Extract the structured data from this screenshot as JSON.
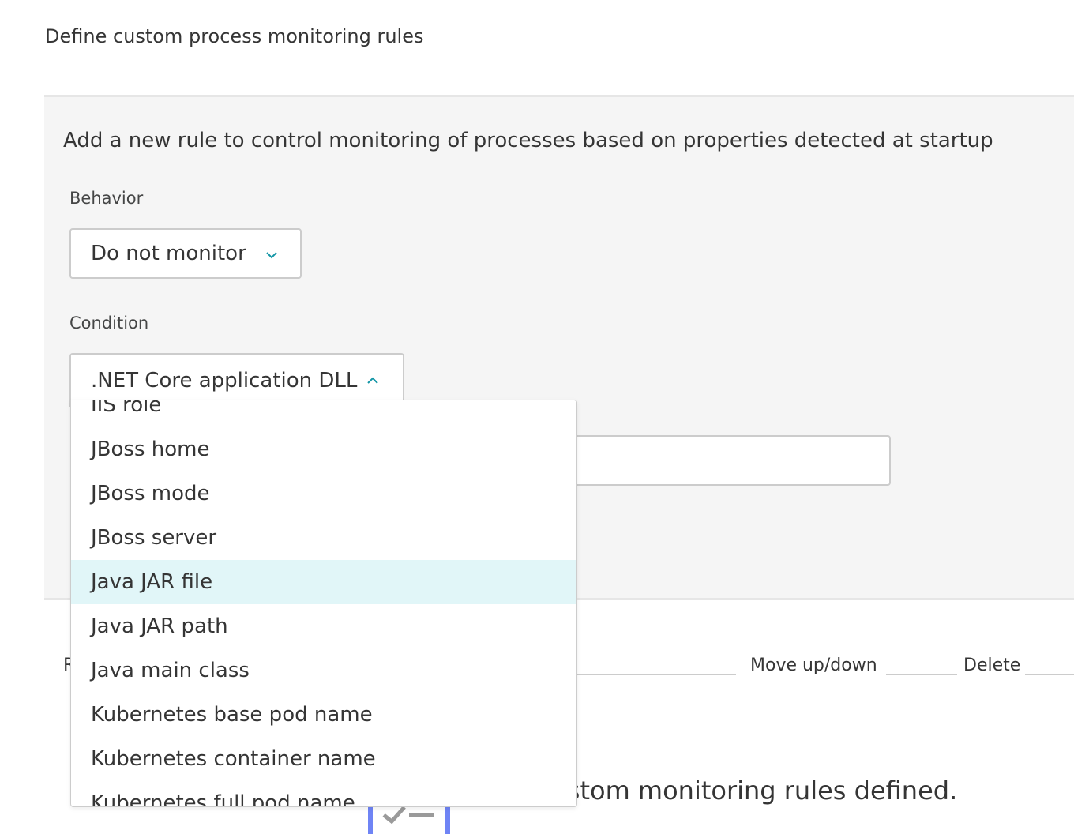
{
  "page": {
    "title": "Define custom process monitoring rules"
  },
  "rule_form": {
    "heading": "Add a new rule to control monitoring of processes based on properties detected at startup",
    "behavior": {
      "label": "Behavior",
      "selected": "Do not monitor"
    },
    "condition": {
      "label": "Condition",
      "selected": ".NET Core application DLL",
      "open": true,
      "options": [
        "IIS role",
        "JBoss home",
        "JBoss mode",
        "JBoss server",
        "Java JAR file",
        "Java JAR path",
        "Java main class",
        "Kubernetes base pod name",
        "Kubernetes container name",
        "Kubernetes full pod name"
      ],
      "highlighted_option": "Java JAR file"
    },
    "value_input": {
      "value": ""
    }
  },
  "rules_table": {
    "columns": {
      "first_partial": "R",
      "move": "Move up/down",
      "delete": "Delete"
    },
    "empty_message_partial": "e no custom monitoring rules defined."
  },
  "colors": {
    "accent": "#1496a6",
    "highlight": "#e1f6f8",
    "panel_bg": "#f5f5f5",
    "border": "#cccccc",
    "illustration": "#6f84f5"
  },
  "icons": {
    "behavior_toggle": "chevron-down-icon",
    "condition_toggle": "chevron-up-icon",
    "empty_state": "empty-checklist-icon"
  }
}
